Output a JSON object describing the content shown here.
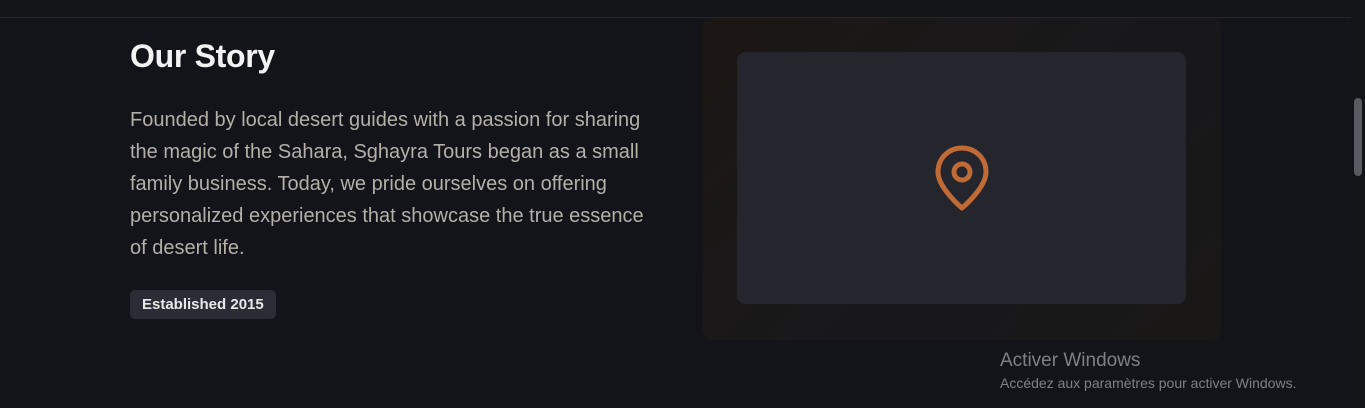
{
  "story": {
    "heading": "Our Story",
    "paragraph": "Founded by local desert guides with a passion for sharing the magic of the Sahara, Sghayra Tours began as a small family business. Today, we pride ourselves on offering personalized experiences that showcase the true essence of desert life.",
    "badge": "Established 2015"
  },
  "media": {
    "icon": "map-pin-icon",
    "icon_color": "#c06a35"
  },
  "watermark": {
    "title": "Activer Windows",
    "subtitle": "Accédez aux paramètres pour activer Windows."
  },
  "colors": {
    "background": "#131419",
    "heading": "#f2f2f2",
    "body_text": "#b4b0a8",
    "badge_bg": "#2a2d35",
    "accent": "#c06a35"
  }
}
